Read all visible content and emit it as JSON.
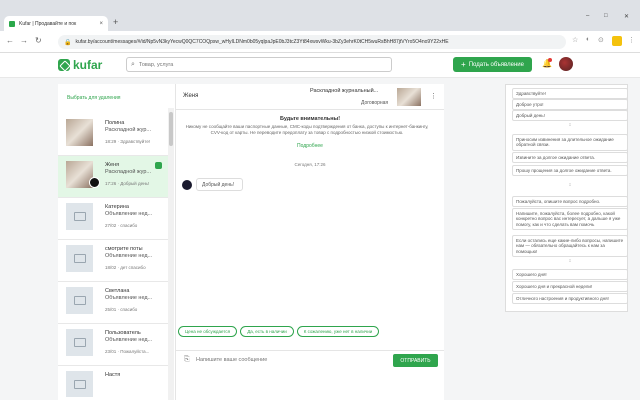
{
  "browser": {
    "tab_title": "Kufar | Продавайте и пок",
    "tab_close": "×",
    "new_tab": "+",
    "url": "kufar.by/account/messages/#/id/Np5vN3kyYecwQ0QC7COQpsw_wHyILDNm0b05yqlpaJpE0bJ3tcZ3Yt84xwsvWku-3bZy3ehrK0tCH5wuRsBhH87jtVYro5O4no9Y22xHE",
    "back": "←",
    "forward": "→",
    "reload": "↻",
    "minimize": "–",
    "maximize": "□",
    "close": "✕"
  },
  "header": {
    "logo": "kufar",
    "search_placeholder": "Товар, услуга",
    "post_button": "Подать объявление",
    "post_plus": "+"
  },
  "conversations": {
    "choose_label": "Выбрать для удаления",
    "items": [
      {
        "name": "Полина",
        "sub": "Раскладной жур...",
        "time": "18:29 · Здравствуйте!",
        "type": "photo",
        "badge": false,
        "dot": false
      },
      {
        "name": "Женя",
        "sub": "Раскладной жур...",
        "time": "17:26 · Добрый день!",
        "type": "photo",
        "badge": false,
        "dot": true
      },
      {
        "name": "Катерина",
        "sub": "Объявление нед...",
        "time": "27/02 · спасибо",
        "type": "placeholder",
        "badge": false,
        "dot": false
      },
      {
        "name": "смотрите поты",
        "sub": "Объявление нед...",
        "time": "18/02 · дет спасибо",
        "type": "placeholder",
        "badge": false,
        "dot": false
      },
      {
        "name": "Светлана",
        "sub": "Объявление нед...",
        "time": "25/01 · спасибо",
        "type": "placeholder",
        "badge": false,
        "dot": false
      },
      {
        "name": "Пользователь",
        "sub": "Объявление нед...",
        "time": "23/01 · Пожалуйста...",
        "type": "placeholder",
        "badge": false,
        "dot": false
      },
      {
        "name": "Настя",
        "sub": "",
        "time": "",
        "type": "placeholder",
        "badge": false,
        "dot": false
      }
    ]
  },
  "chat": {
    "name": "Женя",
    "item_title": "Раскладной журнальный...",
    "item_price": "Договорная",
    "menu": "⋮",
    "warning_title": "Будьте внимательны!",
    "warning_text": "Никому не сообщайте ваши паспортные данные, СМС-коды подтверждения от банка, доступы к интернет-банкингу, CVV-код от карты. Не переводите предоплату за товар с подробностью низкой стоимостью.",
    "warning_more": "Подробнее",
    "day_label": "Сегодня, 17:26",
    "messages": [
      {
        "text": "Добрый день!"
      }
    ],
    "quick_replies": [
      "Цена не обсуждается",
      "Да, есть в наличии",
      "К сожалению, уже нет в наличии"
    ],
    "input_placeholder": "Напишите ваше сообщение",
    "send_button": "ОТПРАВИТЬ",
    "clip": "⎘"
  },
  "templates": {
    "group1": [
      "Здравствуйте!",
      "Доброе утро!",
      "Добрый день!"
    ],
    "group2": [
      "Приносим извинения за длительное ожидание обратной связи.",
      "Извините за долгое ожидание ответа.",
      "Прошу прощения за долгое ожидание ответа."
    ],
    "group3": [
      "Пожалуйста, опишите вопрос подробно.",
      "Напишите, пожалуйста, более подробно, какой конкретно вопрос вас интересует, а дальше я уже помогу, как и что сделать вам помочь",
      "Если остались еще какие-либо вопросы, напишите нам — обязательно обращайтесь к нам за помощью!"
    ],
    "group4": [
      "Хорошего дня!",
      "Хорошего дня и прекрасной недели!",
      "Отличного настроения и продуктивного дня!"
    ],
    "sep": "↕"
  },
  "colors": {
    "brand": "#2fa54d",
    "active_row": "#e3f7e6"
  }
}
